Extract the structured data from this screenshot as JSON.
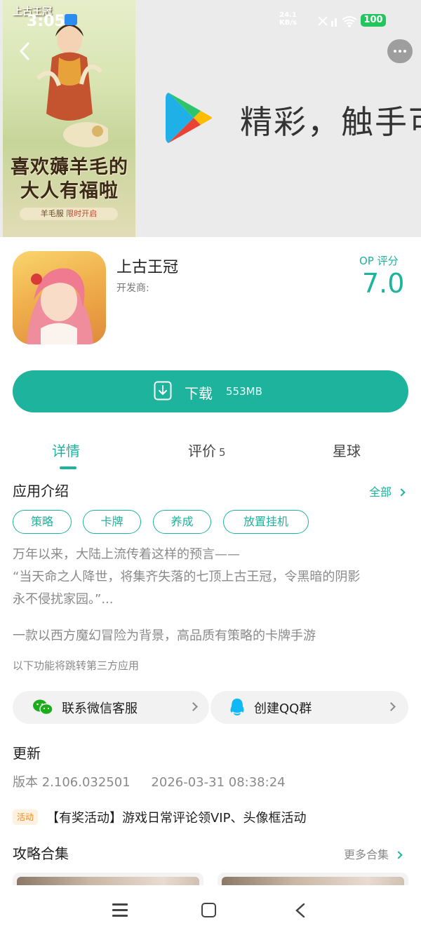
{
  "status_bar": {
    "time": "3:05",
    "speed_value": "24.1",
    "speed_unit": "KB/s",
    "battery": "100"
  },
  "banner": {
    "poster_logo": "上古王冠",
    "poster_slogan_line1": "喜欢薅羊毛的",
    "poster_slogan_line2": "大人有福啦",
    "poster_tag_prefix": "羊毛服",
    "poster_tag_highlight": "限时开启",
    "video_text": "精彩，触手可"
  },
  "app": {
    "name": "上古王冠",
    "developer_label": "开发商:",
    "rating_label": "OP 评分",
    "rating_value": "7.0"
  },
  "download": {
    "label": "下载",
    "size": "553MB"
  },
  "tabs": [
    {
      "label": "详情"
    },
    {
      "label": "评价",
      "count": "5"
    },
    {
      "label": "星球"
    }
  ],
  "intro": {
    "title": "应用介绍",
    "see_all": "全部",
    "tags": [
      "策略",
      "卡牌",
      "养成",
      "放置挂机"
    ],
    "description_lines": [
      "万年以来，大陆上流传着这样的预言——",
      "“当天命之人降世，将集齐失落的七顶上古王冠，令黑暗的阴影",
      "永不侵扰家园。”..."
    ],
    "summary": "一款以西方魔幻冒险为背景，高品质有策略的卡牌手游",
    "third_party_note": "以下功能将跳转第三方应用",
    "contacts": [
      {
        "label": "联系微信客服"
      },
      {
        "label": "创建QQ群"
      }
    ]
  },
  "update": {
    "title": "更新",
    "version": "版本 2.106.032501",
    "date": "2026-03-31 08:38:24",
    "activity_badge": "活动",
    "activity_text": "【有奖活动】游戏日常评论领VIP、头像框活动"
  },
  "collections": {
    "title": "攻略合集",
    "more": "更多合集"
  },
  "colors": {
    "accent": "#1db39c",
    "activity": "#f08a1c"
  }
}
